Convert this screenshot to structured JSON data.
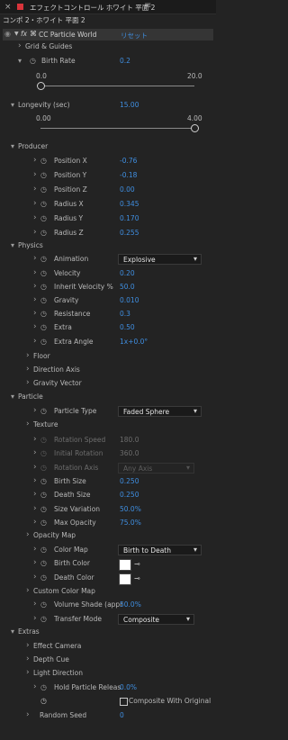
{
  "tab": {
    "close_glyph": "×",
    "title": "エフェクトコントロール ホワイト 平面 2",
    "menu_glyph": "≡"
  },
  "breadcrumb": "コンポ 2・ホワイト 平面 2",
  "effect": {
    "fx_label": "fx",
    "name": "CC Particle World",
    "reset": "リセット"
  },
  "labels": {
    "grid": "Grid & Guides",
    "birth_rate": "Birth Rate",
    "longevity": "Longevity (sec)",
    "producer": "Producer",
    "position_x": "Position X",
    "position_y": "Position Y",
    "position_z": "Position Z",
    "radius_x": "Radius X",
    "radius_y": "Radius Y",
    "radius_z": "Radius Z",
    "physics": "Physics",
    "animation": "Animation",
    "velocity": "Velocity",
    "inherit_velocity": "Inherit Velocity %",
    "gravity": "Gravity",
    "resistance": "Resistance",
    "extra": "Extra",
    "extra_angle": "Extra Angle",
    "floor": "Floor",
    "direction_axis": "Direction Axis",
    "gravity_vector": "Gravity Vector",
    "particle": "Particle",
    "particle_type": "Particle Type",
    "texture": "Texture",
    "rotation_speed": "Rotation Speed",
    "initial_rotation": "Initial Rotation",
    "rotation_axis": "Rotation Axis",
    "birth_size": "Birth Size",
    "death_size": "Death Size",
    "size_variation": "Size Variation",
    "max_opacity": "Max Opacity",
    "opacity_map": "Opacity Map",
    "color_map": "Color Map",
    "birth_color": "Birth Color",
    "death_color": "Death Color",
    "custom_color_map": "Custom Color Map",
    "volume_shade": "Volume Shade (appr",
    "transfer_mode": "Transfer Mode",
    "extras": "Extras",
    "effect_camera": "Effect Camera",
    "depth_cue": "Depth Cue",
    "light_direction": "Light Direction",
    "hold_particle": "Hold Particle Releas",
    "composite_original": "Composite With Original",
    "random_seed": "Random Seed"
  },
  "values": {
    "birth_rate": "0.2",
    "birth_rate_min": "0.0",
    "birth_rate_max": "20.0",
    "longevity": "15.00",
    "longevity_min": "0.00",
    "longevity_max": "4.00",
    "position_x": "-0.76",
    "position_y": "-0.18",
    "position_z": "0.00",
    "radius_x": "0.345",
    "radius_y": "0.170",
    "radius_z": "0.255",
    "animation": "Explosive",
    "velocity": "0.20",
    "inherit_velocity": "50.0",
    "gravity": "0.010",
    "resistance": "0.3",
    "extra": "0.50",
    "extra_angle": "1x+0.0°",
    "particle_type": "Faded Sphere",
    "rotation_speed": "180.0",
    "initial_rotation": "360.0",
    "rotation_axis": "Any Axis",
    "birth_size": "0.250",
    "death_size": "0.250",
    "size_variation": "50.0%",
    "max_opacity": "75.0%",
    "color_map": "Birth to Death",
    "volume_shade": "50.0%",
    "transfer_mode": "Composite",
    "hold_particle": "0.0%",
    "random_seed": "0"
  },
  "sliders": {
    "birth_rate_fraction": 0.0,
    "longevity_fraction": 1.0
  },
  "colors": {
    "birth_color": "#ffffff",
    "death_color": "#ffffff",
    "value_blue": "#3f8ee0",
    "tab_red": "#d8343b"
  },
  "glyphs": {
    "expanded": "⌄",
    "collapsed": "›",
    "stopwatch": "◷",
    "chevron": "⌄",
    "eyedropper": "✎"
  }
}
